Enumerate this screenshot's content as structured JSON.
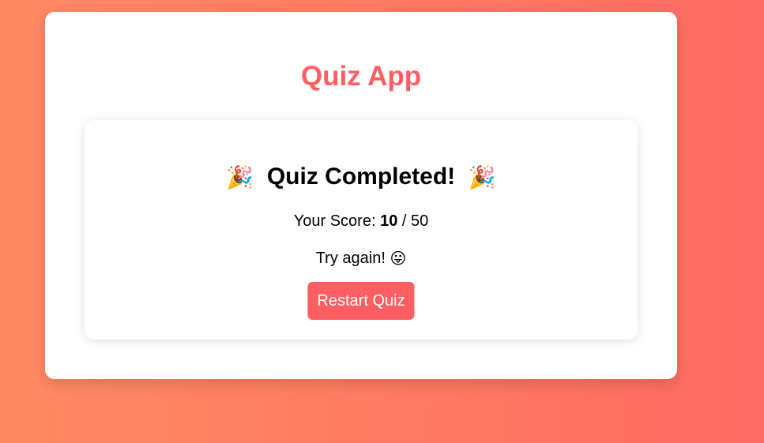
{
  "app": {
    "title": "Quiz App"
  },
  "result": {
    "heading": "Quiz Completed!",
    "party_emoji": "🎉",
    "score_label": "Your Score:",
    "score_value": "10",
    "score_separator": "/",
    "score_total": "50",
    "feedback_text": "Try again!",
    "feedback_emoji": "😛",
    "restart_label": "Restart Quiz"
  },
  "colors": {
    "accent": "#ff5e62",
    "background_start": "#ff8a63",
    "background_end": "#ff6b63"
  },
  "icons": {
    "party": "party-popper-icon",
    "feedback": "tongue-face-icon"
  }
}
